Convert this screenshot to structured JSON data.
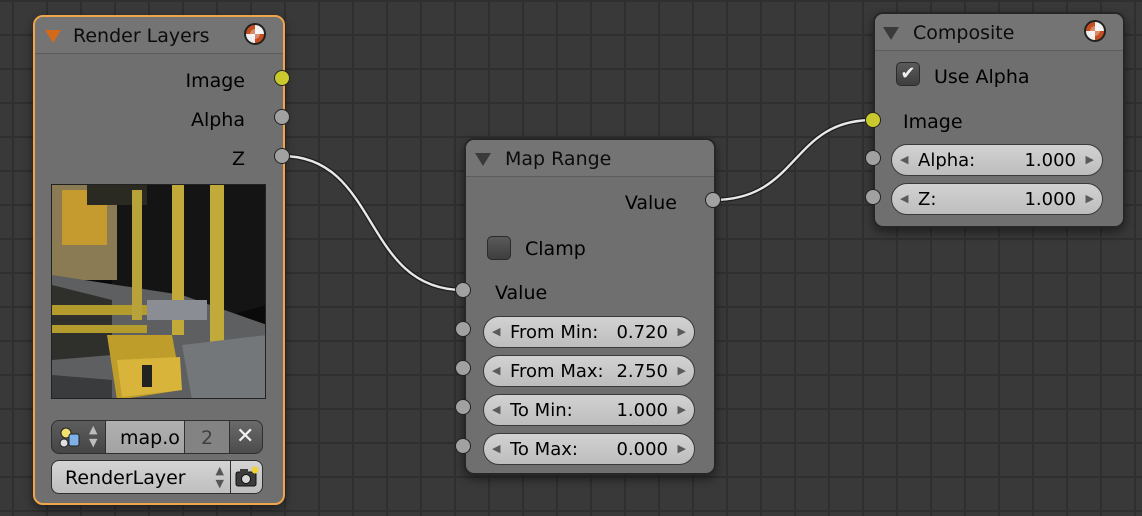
{
  "render_layers": {
    "title": "Render Layers",
    "outputs": [
      "Image",
      "Alpha",
      "Z"
    ],
    "image_name": "map.o",
    "user_count": "2",
    "layer_select": "RenderLayer"
  },
  "map_range": {
    "title": "Map Range",
    "output_label": "Value",
    "clamp_label": "Clamp",
    "clamp_checked": false,
    "input_label": "Value",
    "fields": [
      {
        "name": "From Min:",
        "value": "0.720"
      },
      {
        "name": "From Max:",
        "value": "2.750"
      },
      {
        "name": "To Min:",
        "value": "1.000"
      },
      {
        "name": "To Max:",
        "value": "0.000"
      }
    ]
  },
  "composite": {
    "title": "Composite",
    "use_alpha_label": "Use Alpha",
    "use_alpha_checked": true,
    "image_label": "Image",
    "fields": [
      {
        "name": "Alpha:",
        "value": "1.000"
      },
      {
        "name": "Z:",
        "value": "1.000"
      }
    ]
  },
  "icons": {
    "collapse": "triangle-down-icon",
    "material_ball": "material-ball-icon",
    "image_browse": "image-browse-icon",
    "unlink": "x-icon",
    "camera": "camera-render-icon"
  },
  "colors": {
    "canvas": "#393939",
    "grid": "#2f2f2f",
    "node_body": "#6f6f6f",
    "selected_outline": "#f1a54a",
    "image_socket": "#c9c92e",
    "value_socket": "#a1a1a1",
    "link": "#e8e8e8"
  }
}
